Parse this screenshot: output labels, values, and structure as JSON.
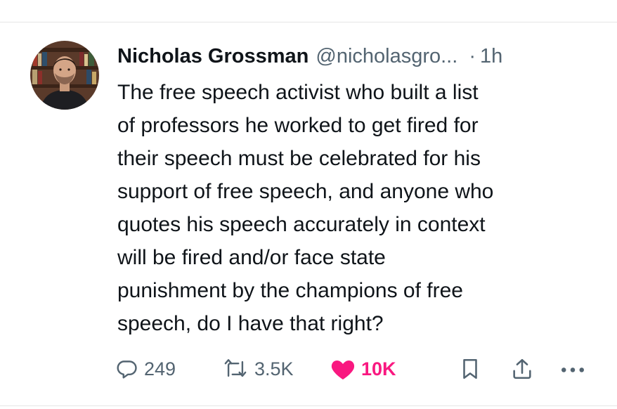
{
  "tweet": {
    "author": {
      "display_name": "Nicholas Grossman",
      "handle": "@nicholasgro...",
      "avatar_icon": "profile-photo"
    },
    "separator": "·",
    "time": "1h",
    "text_lines": [
      "The free speech activist who built a list",
      "of professors he worked to get fired for",
      "their speech must be celebrated for his",
      "support of free speech, and anyone who",
      "quotes his speech accurately in context",
      "will be fired and/or face state",
      "punishment by the champions of free",
      "speech, do I have that right?"
    ],
    "actions": {
      "replies": "249",
      "reposts": "3.5K",
      "likes": "10K",
      "liked": true
    }
  },
  "colors": {
    "text": "#0f1419",
    "secondary": "#536471",
    "like": "#f91880",
    "divider": "#e6e6e6"
  },
  "icons": [
    "reply-icon",
    "repost-icon",
    "heart-icon",
    "bookmark-icon",
    "share-icon",
    "more-icon"
  ]
}
